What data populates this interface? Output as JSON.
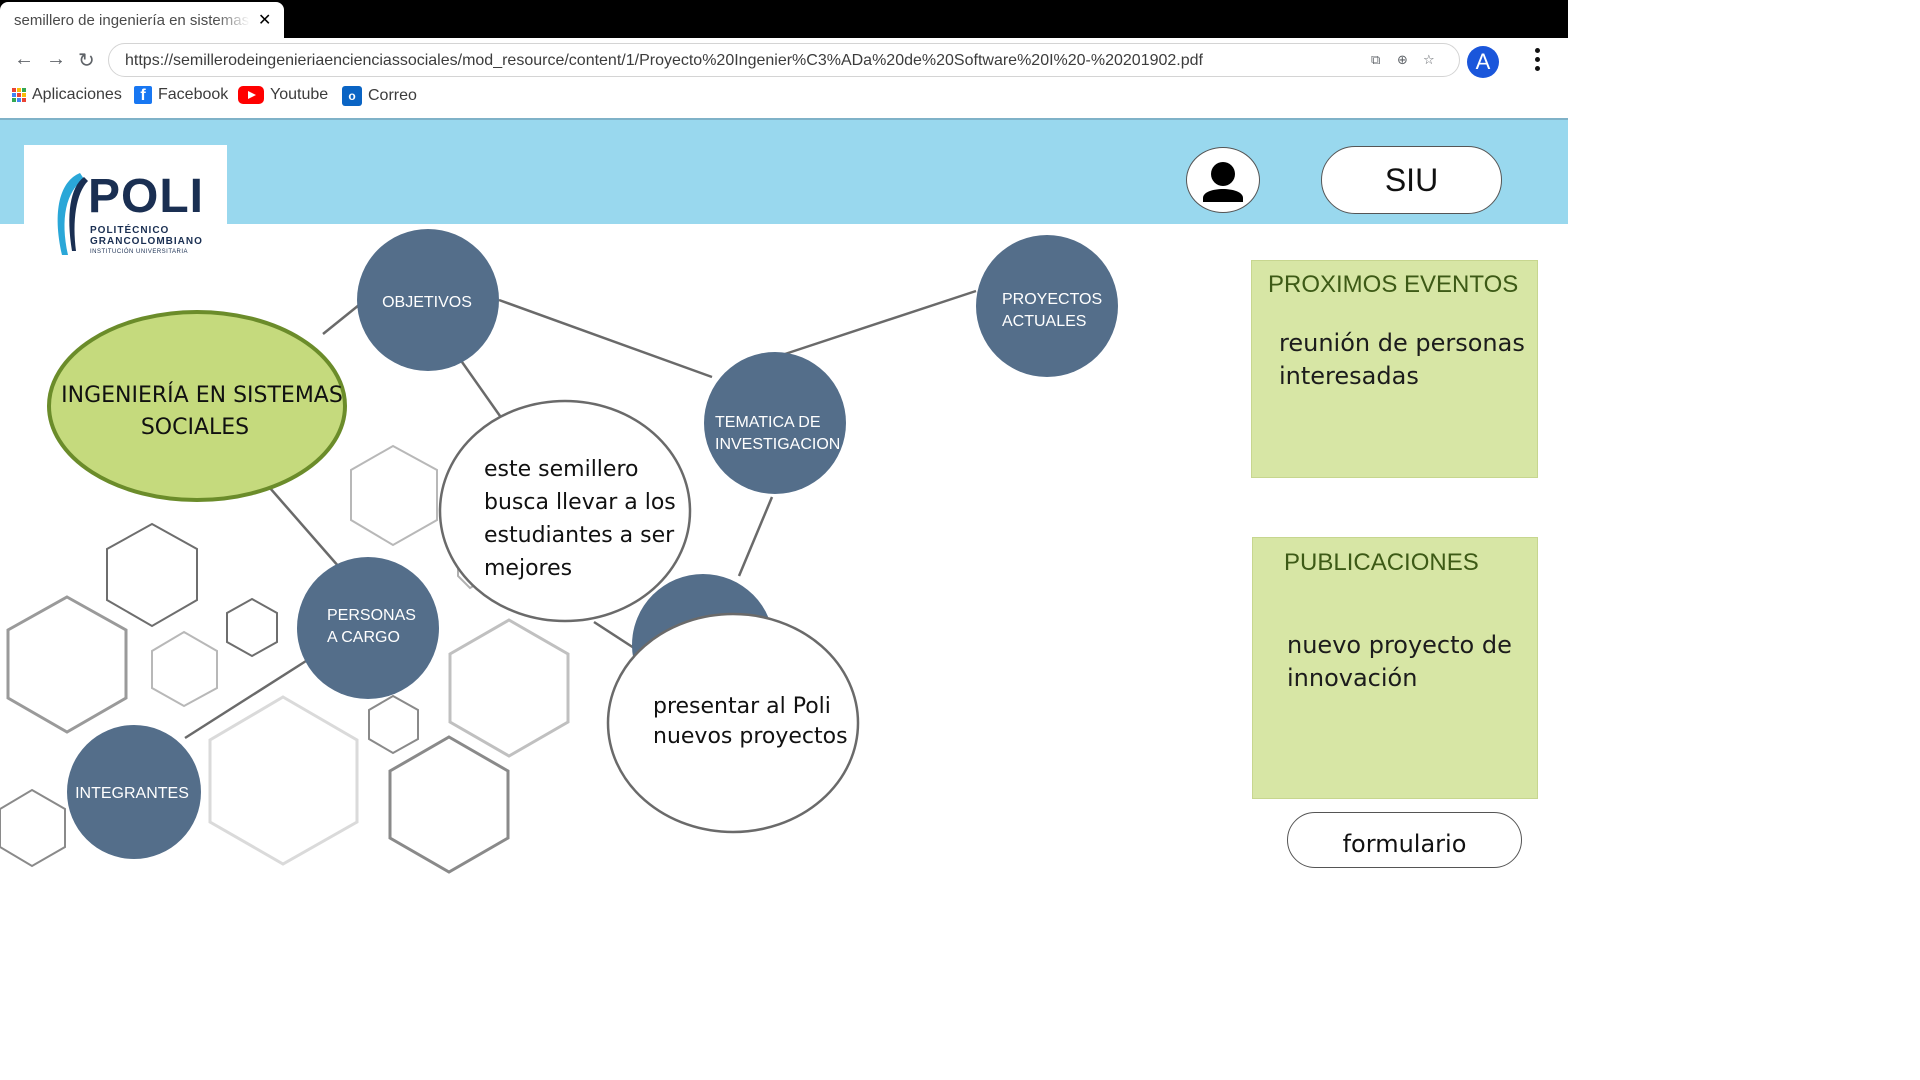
{
  "browser": {
    "tab_title": "semillero de ingeniería en sistemas sociales",
    "url": "https://semillerodeingenieriaencienciassociales/mod_resource/content/1/Proyecto%20Ingenier%C3%ADa%20de%20Software%20I%20-%20201902.pdf",
    "profile_initial": "A",
    "bookmarks": [
      {
        "label": "Aplicaciones",
        "icon": "apps-grid-icon"
      },
      {
        "label": "Facebook",
        "icon": "facebook-icon"
      },
      {
        "label": "Youtube",
        "icon": "youtube-icon"
      },
      {
        "label": "Correo",
        "icon": "outlook-icon"
      }
    ]
  },
  "header": {
    "logo": {
      "name": "POLI",
      "line1": "POLITÉCNICO",
      "line2": "GRANCOLOMBIANO",
      "line3": "INSTITUCIÓN UNIVERSITARIA"
    },
    "user_icon": "user-icon",
    "siu_label": "SIU",
    "color": "#99d8ee"
  },
  "mindmap": {
    "center": [
      "INGENIERÍA EN SISTEMAS",
      "SOCIALES"
    ],
    "nodes": {
      "objetivos": [
        "OBJETIVOS"
      ],
      "proyectos": [
        "PROYECTOS",
        "ACTUALES"
      ],
      "tematica": [
        "TEMATICA DE",
        "INVESTIGACION"
      ],
      "personas": [
        "PERSONAS",
        "A CARGO"
      ],
      "integrantes": [
        "INTEGRANTES"
      ]
    },
    "bubbles": {
      "semillero": [
        "este semillero",
        "busca llevar a los",
        "estudiantes a ser",
        "mejores"
      ],
      "presentar": [
        "presentar al Poli",
        "nuevos proyectos"
      ]
    },
    "colors": {
      "center_fill": "#c5da7d",
      "center_border": "#6b8c2a",
      "node_fill": "#546e8a"
    }
  },
  "sidebar": {
    "events": {
      "title": "PROXIMOS EVENTOS",
      "line1": "reunión de personas",
      "line2": "interesadas"
    },
    "publications": {
      "title": "PUBLICACIONES",
      "line1": "nuevo proyecto de",
      "line2": "innovación"
    },
    "form_label": "formulario",
    "panel_color": "#d7e6a5"
  }
}
